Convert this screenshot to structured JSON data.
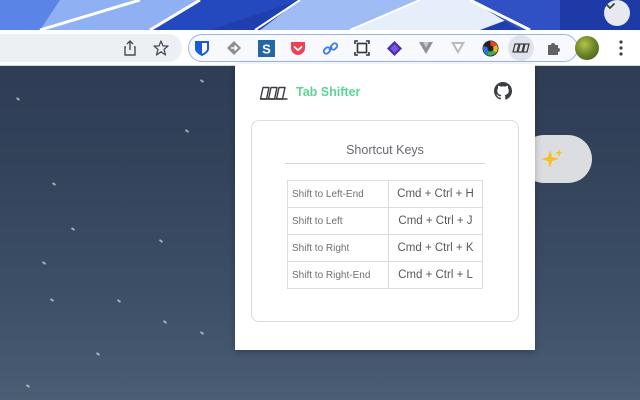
{
  "browser": {
    "tabstrip_color": "#1f3fae",
    "tab_search_icon": "chevron-down-icon",
    "toolbar": {
      "share_icon": "share-icon",
      "bookmark_icon": "star-icon"
    },
    "extensions": [
      {
        "name": "bitwarden-icon",
        "color": "#175ddc"
      },
      {
        "name": "diamond-arrow-icon",
        "color": "#8a8f96"
      },
      {
        "name": "s-app-icon",
        "color": "#2467a8"
      },
      {
        "name": "pocket-icon",
        "color": "#ef4056"
      },
      {
        "name": "link-icon",
        "color": "#3b7be8"
      },
      {
        "name": "screenshot-frame-icon",
        "color": "#333333"
      },
      {
        "name": "layers-icon",
        "color": "#4b2ca8"
      },
      {
        "name": "v-logo-icon",
        "color": "#8d9198"
      },
      {
        "name": "v-logo-outline-icon",
        "color": "#9aa0a6"
      },
      {
        "name": "color-wheel-icon",
        "color": "#e04a2b"
      },
      {
        "name": "tab-shifter-icon",
        "color": "#3c4043"
      },
      {
        "name": "puzzle-icon",
        "color": "#5f6368"
      }
    ],
    "menu_icon": "kebab-menu-icon"
  },
  "popup": {
    "title": "Tab Shifter",
    "title_color": "#5fd49a",
    "github_icon": "github-icon",
    "section_title": "Shortcut Keys",
    "shortcuts": [
      {
        "action": "Shift to Left-End",
        "keys": "Cmd + Ctrl + H"
      },
      {
        "action": "Shift to Left",
        "keys": "Cmd + Ctrl + J"
      },
      {
        "action": "Shift to Right",
        "keys": "Cmd + Ctrl + K"
      },
      {
        "action": "Shift to Right-End",
        "keys": "Cmd + Ctrl + L"
      }
    ]
  },
  "page": {
    "sparkle_icon": "sparkle-icon"
  }
}
